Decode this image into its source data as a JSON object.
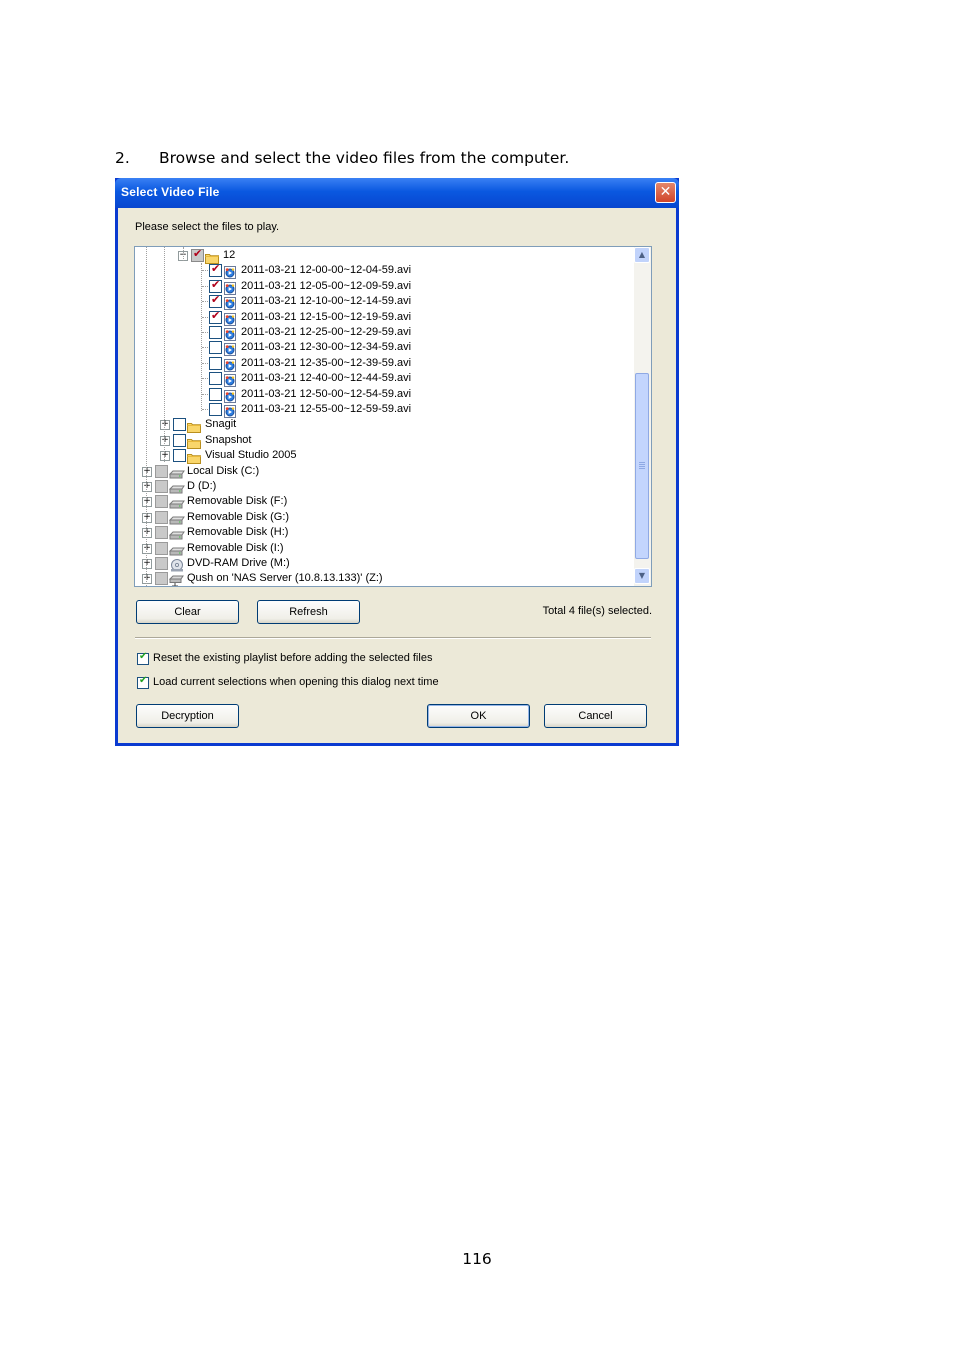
{
  "step": {
    "number": "2.",
    "text": "Browse and select the video files from the computer."
  },
  "dialog": {
    "title": "Select Video File",
    "close_glyph": "✕",
    "prompt": "Please select the files to play.",
    "tree": {
      "folder12": {
        "label": "12",
        "state": "partial"
      },
      "files": [
        {
          "label": "2011-03-21 12-00-00~12-04-59.avi",
          "checked": true
        },
        {
          "label": "2011-03-21 12-05-00~12-09-59.avi",
          "checked": true
        },
        {
          "label": "2011-03-21 12-10-00~12-14-59.avi",
          "checked": true
        },
        {
          "label": "2011-03-21 12-15-00~12-19-59.avi",
          "checked": true
        },
        {
          "label": "2011-03-21 12-25-00~12-29-59.avi",
          "checked": false
        },
        {
          "label": "2011-03-21 12-30-00~12-34-59.avi",
          "checked": false
        },
        {
          "label": "2011-03-21 12-35-00~12-39-59.avi",
          "checked": false
        },
        {
          "label": "2011-03-21 12-40-00~12-44-59.avi",
          "checked": false
        },
        {
          "label": "2011-03-21 12-50-00~12-54-59.avi",
          "checked": false
        },
        {
          "label": "2011-03-21 12-55-00~12-59-59.avi",
          "checked": false
        }
      ],
      "folders": [
        {
          "label": "Snagit"
        },
        {
          "label": "Snapshot"
        },
        {
          "label": "Visual Studio 2005"
        }
      ],
      "drives": [
        {
          "label": "Local Disk (C:)",
          "icon": "hard-drive-icon"
        },
        {
          "label": "D (D:)",
          "icon": "hard-drive-icon"
        },
        {
          "label": "Removable Disk (F:)",
          "icon": "removable-drive-icon"
        },
        {
          "label": "Removable Disk (G:)",
          "icon": "removable-drive-icon"
        },
        {
          "label": "Removable Disk (H:)",
          "icon": "removable-drive-icon"
        },
        {
          "label": "Removable Disk (I:)",
          "icon": "removable-drive-icon"
        },
        {
          "label": "DVD-RAM Drive (M:)",
          "icon": "dvd-drive-icon"
        },
        {
          "label": "Qush on 'NAS Server (10.8.13.133)' (Z:)",
          "icon": "network-drive-icon"
        }
      ],
      "expand_glyph": "+",
      "collapse_glyph": "−",
      "tick_glyph": "✔"
    },
    "buttons": {
      "clear": "Clear",
      "refresh": "Refresh",
      "decryption": "Decryption",
      "ok": "OK",
      "cancel": "Cancel"
    },
    "status": "Total 4 file(s) selected.",
    "options": [
      {
        "label": "Reset the existing playlist before adding the selected files",
        "checked": true
      },
      {
        "label": "Load current selections when opening this dialog next time",
        "checked": true
      }
    ],
    "scroll_up": "▲",
    "scroll_down": "▼"
  },
  "page_number": "116"
}
